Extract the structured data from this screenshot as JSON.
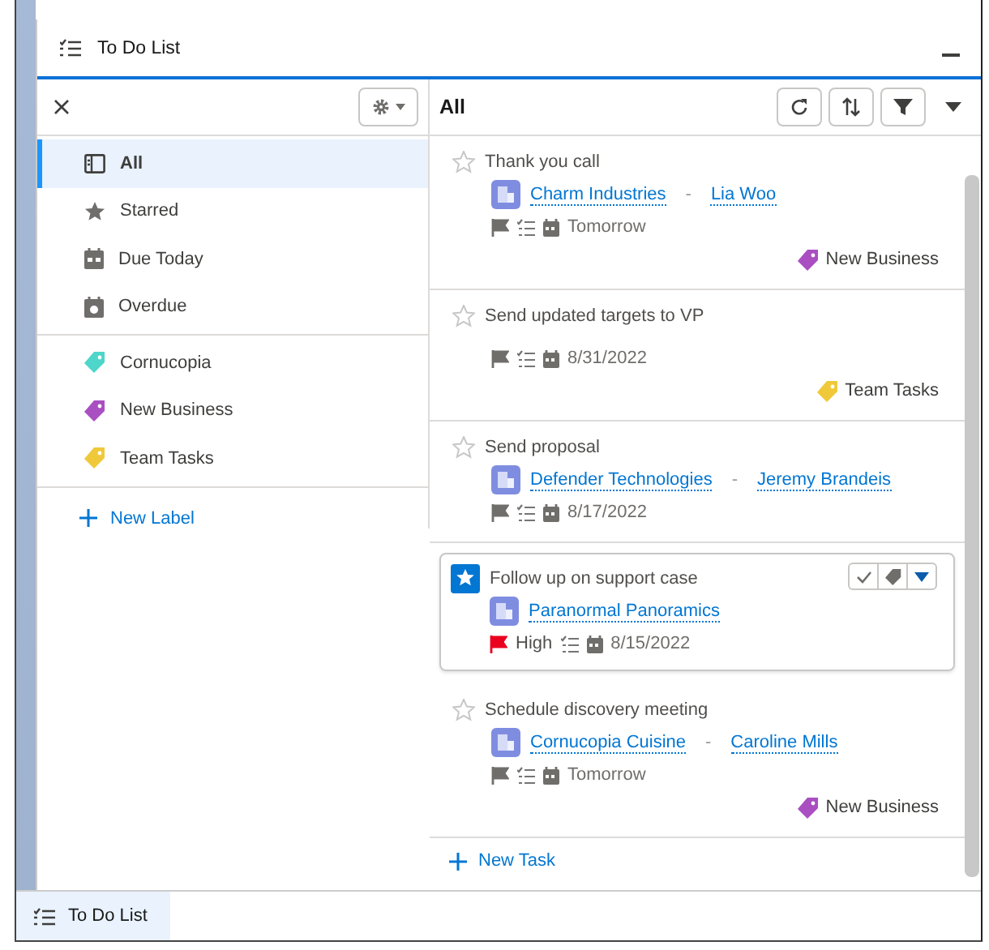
{
  "window": {
    "title": "To Do List"
  },
  "sidebar": {
    "views": [
      {
        "label": "All",
        "selected": true
      },
      {
        "label": "Starred",
        "selected": false
      },
      {
        "label": "Due Today",
        "selected": false
      },
      {
        "label": "Overdue",
        "selected": false
      }
    ],
    "labels": [
      {
        "label": "Cornucopia",
        "color": "#4dd6c9"
      },
      {
        "label": "New Business",
        "color": "#a94fc1"
      },
      {
        "label": "Team Tasks",
        "color": "#f0c93a"
      }
    ],
    "new_label": "New Label"
  },
  "content": {
    "heading": "All",
    "tasks": [
      {
        "title": "Thank you call",
        "starred": false,
        "selected": false,
        "account": "Charm Industries",
        "separator": "-",
        "contact": "Lia Woo",
        "date": "Tomorrow",
        "label": {
          "name": "New Business",
          "color": "#a94fc1"
        }
      },
      {
        "title": "Send updated targets to VP",
        "starred": false,
        "selected": false,
        "date": "8/31/2022",
        "label": {
          "name": "Team Tasks",
          "color": "#f0c93a"
        }
      },
      {
        "title": "Send proposal",
        "starred": false,
        "selected": false,
        "account": "Defender Technologies",
        "separator": "-",
        "contact": "Jeremy Brandeis",
        "date": "8/17/2022"
      },
      {
        "title": "Follow up on support case",
        "starred": true,
        "selected": true,
        "account": "Paranormal Panoramics",
        "priority": "High",
        "date": "8/15/2022"
      },
      {
        "title": "Schedule discovery meeting",
        "starred": false,
        "selected": false,
        "account": "Cornucopia Cuisine",
        "separator": "-",
        "contact": "Caroline Mills",
        "date": "Tomorrow",
        "label": {
          "name": "New Business",
          "color": "#a94fc1"
        }
      }
    ],
    "new_task": "New Task"
  },
  "footer": {
    "tabs": [
      {
        "label": "To Do List",
        "selected": true
      }
    ]
  }
}
